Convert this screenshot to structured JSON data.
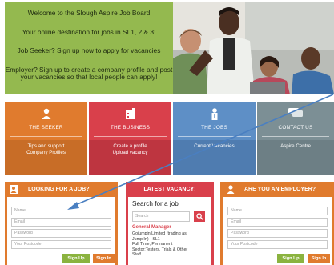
{
  "hero": {
    "line1": "Welcome to the Slough Aspire Job Board",
    "line2": "Your online destination for jobs in SL1, 2 & 3!",
    "line3": "Job Seeker? Sign up now to apply for vacancies",
    "line4": "Employer? Sign up to create a company profile and post your vacancies so that local people can apply!"
  },
  "tiles": [
    {
      "title": "THE SEEKER",
      "sub1": "Tips and support",
      "sub2": "Company Profiles",
      "color": "#e07b2e",
      "band": "#c86d27",
      "icon": "user-icon"
    },
    {
      "title": "THE BUSINESS",
      "sub1": "Create a profile",
      "sub2": "Upload vacancy",
      "color": "#d9404b",
      "band": "#be3540",
      "icon": "building-icon"
    },
    {
      "title": "THE JOBS",
      "sub1": "Current Vacancies",
      "sub2": "",
      "color": "#5e8fc6",
      "band": "#4f7cb0",
      "icon": "person-icon"
    },
    {
      "title": "CONTACT US",
      "sub1": "Aspire Centre",
      "sub2": "",
      "color": "#7c8f95",
      "band": "#6d7f85",
      "icon": "chat-icon"
    }
  ],
  "seeker_panel": {
    "header": "LOOKING FOR A JOB?",
    "name_ph": "Name",
    "email_ph": "Email",
    "password_ph": "Password",
    "postcode_ph": "Your Postcode",
    "signup": "Sign Up",
    "signin": "Sign In"
  },
  "vacancy_panel": {
    "header": "LATEST VACANCY!",
    "search_title": "Search for a job",
    "search_ph": "Search",
    "job_title": "General Manager",
    "job_lines": [
      "Gojumpin Limited (trading as",
      "Jump In) - SL1",
      "Full Time, Permanent",
      "Sector:Testers, Trials & Other",
      "Staff"
    ]
  },
  "employer_panel": {
    "header": "ARE YOU AN EMPLOYER?",
    "name_ph": "Name",
    "email_ph": "Email",
    "password_ph": "Password",
    "postcode_ph": "Your Postcode",
    "signup": "Sign Up",
    "signin": "Sign In"
  },
  "colors": {
    "orange": "#e07b2e",
    "red": "#d9404b",
    "green": "#8bb33f",
    "hero_green": "#94b94f",
    "arrow": "#4a7fc1"
  }
}
